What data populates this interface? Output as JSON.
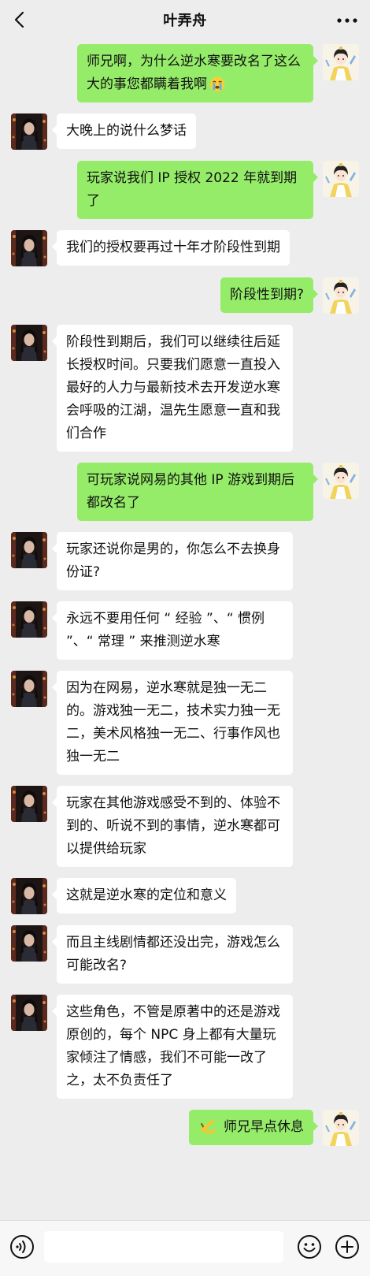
{
  "header": {
    "title": "叶弄舟"
  },
  "messages": [
    {
      "side": "right",
      "text": "师兄啊，为什么逆水寒要改名了这么大的事您都瞒着我啊",
      "emoji": "crying-face"
    },
    {
      "side": "left",
      "text": "大晚上的说什么梦话"
    },
    {
      "side": "right",
      "text": "玩家说我们 IP 授权 2022 年就到期了"
    },
    {
      "side": "left",
      "text": "我们的授权要再过十年才阶段性到期"
    },
    {
      "side": "right",
      "text": "阶段性到期?"
    },
    {
      "side": "left",
      "text": "阶段性到期后，我们可以继续往后延长授权时间。只要我们愿意一直投入最好的人力与最新技术去开发逆水寒会呼吸的江湖，温先生愿意一直和我们合作"
    },
    {
      "side": "right",
      "text": "可玩家说网易的其他 IP 游戏到期后都改名了"
    },
    {
      "side": "left",
      "text": "玩家还说你是男的，你怎么不去换身份证?"
    },
    {
      "side": "left",
      "text": "永远不要用任何 “ 经验 ”、“ 惯例 ”、“ 常理 ” 来推测逆水寒"
    },
    {
      "side": "left",
      "text": "因为在网易，逆水寒就是独一无二的。游戏独一无二，技术实力独一无二，美术风格独一无二、行事作风也独一无二"
    },
    {
      "side": "left",
      "text": "玩家在其他游戏感受不到的、体验不到的、听说不到的事情，逆水寒都可以提供给玩家"
    },
    {
      "side": "left",
      "text": "这就是逆水寒的定位和意义"
    },
    {
      "side": "left",
      "text": "而且主线剧情都还没出完，游戏怎么可能改名?"
    },
    {
      "side": "left",
      "text": "这些角色，不管是原著中的还是游戏原创的，每个 NPC 身上都有大量玩家倾注了情感，我们不可能一改了之，太不负责任了"
    },
    {
      "side": "right",
      "text": "师兄早点休息",
      "lead_emoji": "banana"
    }
  ],
  "input": {
    "value": ""
  },
  "colors": {
    "background": "#ededed",
    "bubble_self": "#95ec69",
    "bubble_other": "#ffffff"
  }
}
